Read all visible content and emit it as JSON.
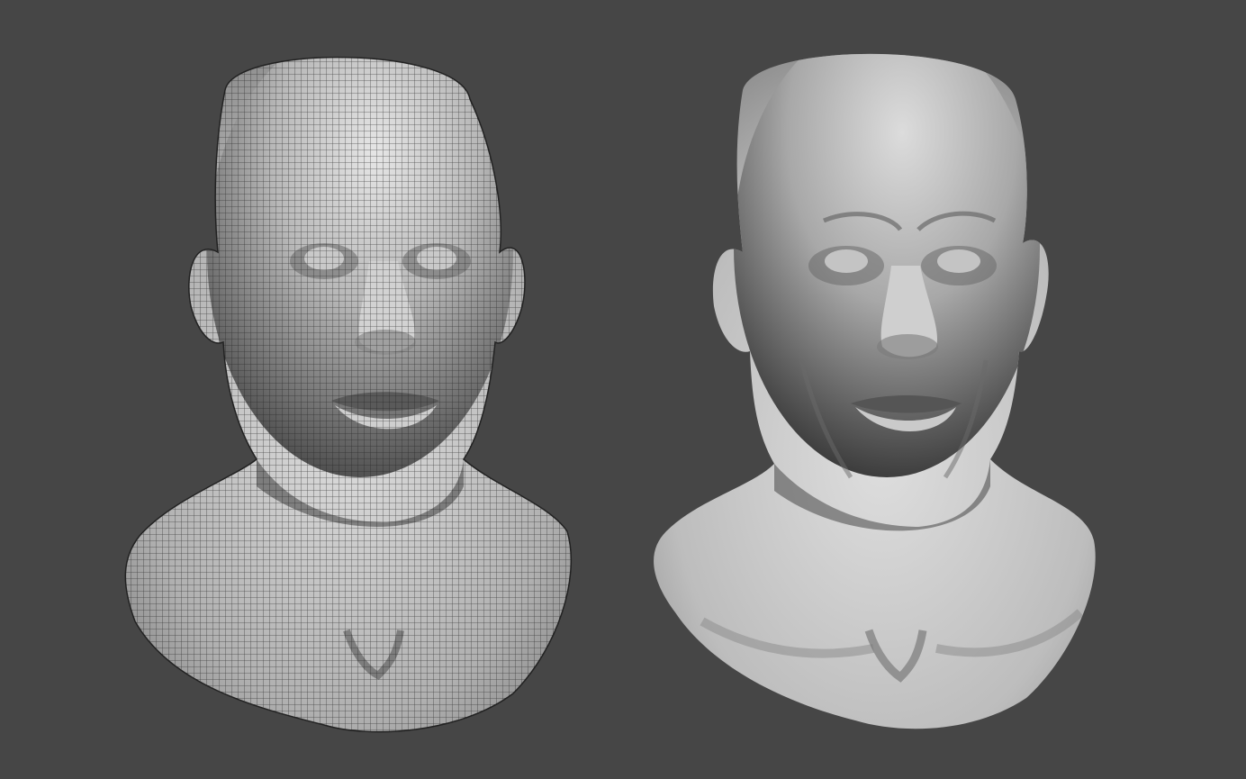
{
  "viewport": {
    "background": "#464646",
    "models": [
      {
        "name": "head-bust-wireframe",
        "shading": "matcap-with-wireframe"
      },
      {
        "name": "head-bust-smooth",
        "shading": "matcap-smooth"
      }
    ]
  },
  "colors": {
    "skin_light": "#d8d8d8",
    "skin_mid": "#a9a9a9",
    "skin_dark": "#5c5c5c",
    "wire": "#2b2b2b"
  }
}
